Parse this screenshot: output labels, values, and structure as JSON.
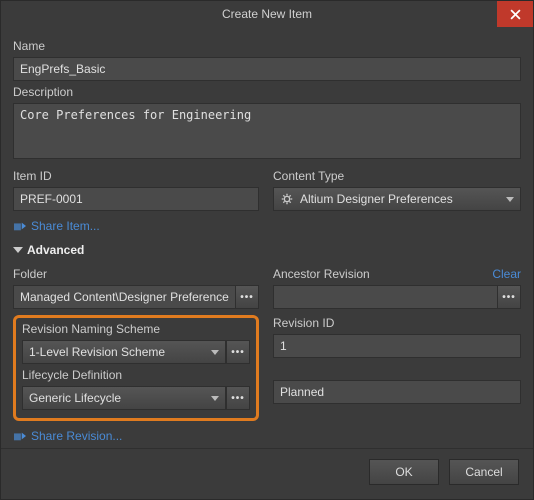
{
  "titlebar": {
    "title": "Create New Item"
  },
  "fields": {
    "name_label": "Name",
    "name_value": "EngPrefs_Basic",
    "description_label": "Description",
    "description_value": "Core Preferences for Engineering",
    "item_id_label": "Item ID",
    "item_id_value": "PREF-0001",
    "content_type_label": "Content Type",
    "content_type_value": "Altium Designer Preferences"
  },
  "links": {
    "share_item": "Share Item...",
    "share_revision": "Share Revision..."
  },
  "advanced": {
    "header": "Advanced",
    "folder_label": "Folder",
    "folder_value": "Managed Content\\Designer Preferences",
    "ancestor_label": "Ancestor Revision",
    "clear_label": "Clear",
    "ancestor_value": "",
    "revision_scheme_label": "Revision Naming Scheme",
    "revision_scheme_value": "1-Level Revision Scheme",
    "revision_id_label": "Revision ID",
    "revision_id_value": "1",
    "lifecycle_label": "Lifecycle Definition",
    "lifecycle_value": "Generic Lifecycle",
    "lifecycle_state": "Planned"
  },
  "buttons": {
    "ok": "OK",
    "cancel": "Cancel"
  }
}
